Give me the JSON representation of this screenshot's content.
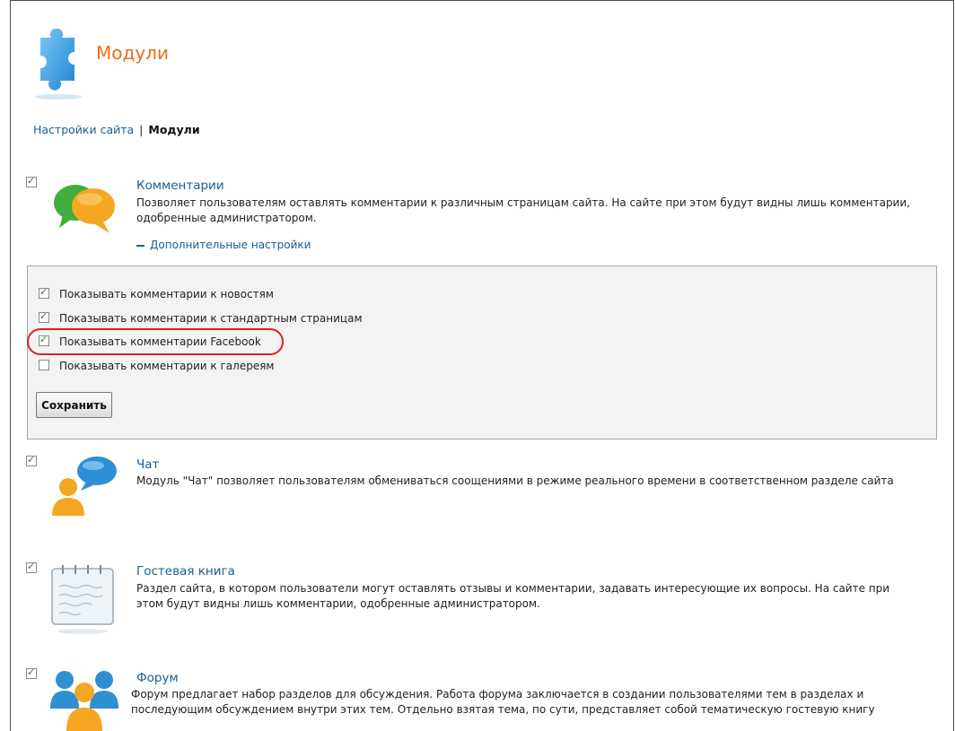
{
  "header": {
    "title": "Модули",
    "icon": "puzzle-icon"
  },
  "breadcrumb": {
    "parent": "Настройки сайта",
    "separator": "|",
    "current": "Модули"
  },
  "modules": [
    {
      "icon": "comments-icon",
      "enabled": true,
      "title": "Комментарии",
      "desc1": "Позволяет пользователям оставлять комментарии к различным страницам сайта. На сайте при этом будут видны лишь комментарии,",
      "desc2": "одобренные администратором.",
      "more": "Дополнительные настройки"
    },
    {
      "icon": "chat-icon",
      "enabled": true,
      "title": "Чат",
      "desc1": "Модуль \"Чат\" позволяет пользователям обмениваться соощениями в режиме реального времени в соответственном разделе сайта"
    },
    {
      "icon": "guestbook-icon",
      "enabled": true,
      "title": "Гостевая книга",
      "desc1": "Раздел сайта, в котором пользователи могут оставлять отзывы и комментарии, задавать интересующие их вопросы. На сайте при",
      "desc2": "этом будут видны лишь комментарии, одобренные администратором."
    },
    {
      "icon": "forum-icon",
      "enabled": true,
      "title": "Форум",
      "desc1": "Форум предлагает набор разделов для обсуждения. Работа форума заключается в создании пользователями тем в разделах и",
      "desc2": "последующим обсуждением внутри этих тем. Отдельно взятая тема, по сути, представляет собой тематическую гостевую книгу"
    }
  ],
  "settings": {
    "options": [
      {
        "label": "Показывать комментарии к новостям",
        "checked": true
      },
      {
        "label": "Показывать комментарии к стандартным страницам",
        "checked": true
      },
      {
        "label": "Показывать комментарии Facebook",
        "checked": true
      },
      {
        "label": "Показывать комментарии к галереям",
        "checked": false
      }
    ],
    "save_label": "Сохранить"
  },
  "colors": {
    "link": "#1a5d95",
    "title": "#ec6d1a",
    "highlight": "#e02020"
  }
}
